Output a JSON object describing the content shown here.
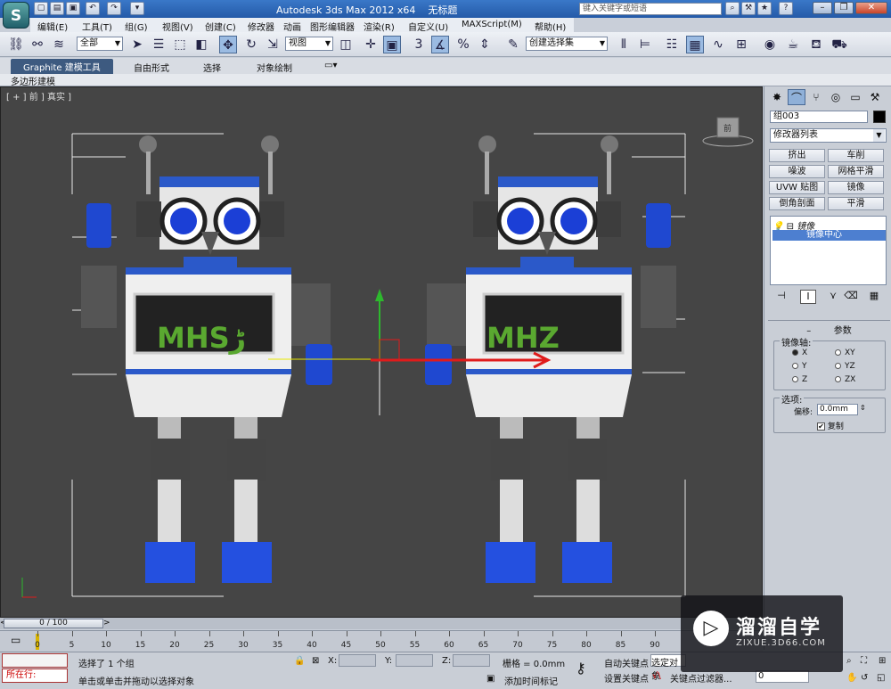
{
  "titlebar": {
    "app": "Autodesk 3ds Max  2012 x64",
    "doc": "无标题",
    "search_placeholder": "键入关键字或短语"
  },
  "menu": [
    "编辑(E)",
    "工具(T)",
    "组(G)",
    "视图(V)",
    "创建(C)",
    "修改器",
    "动画",
    "图形编辑器",
    "渲染(R)",
    "自定义(U)",
    "MAXScript(M)",
    "帮助(H)"
  ],
  "toolbar": {
    "selection_filter": "全部",
    "ref_coord": "视图",
    "named_selection": "创建选择集",
    "angle_snap": "3"
  },
  "ribbon": {
    "tabs": [
      "Graphite 建模工具",
      "自由形式",
      "选择",
      "对象绘制"
    ],
    "sub": "多边形建模"
  },
  "viewport": {
    "label": "[ + ] 前 ] 真实 ]",
    "view_cube_label": "前",
    "screen_text_left": "MHSڑ",
    "screen_text_right": "MHZ"
  },
  "command_panel": {
    "object_name": "组003",
    "modifier_list": "修改器列表",
    "modifier_buttons": [
      "挤出",
      "车削",
      "噪波",
      "网格平滑",
      "UVW 贴图",
      "镜像",
      "倒角剖面",
      "平滑"
    ],
    "stack_top": "镜像",
    "stack_sub": "镜像中心",
    "params_header": "参数",
    "mirror_axis_title": "镜像轴:",
    "axes": [
      "X",
      "XY",
      "Y",
      "YZ",
      "Z",
      "ZX"
    ],
    "options_title": "选项:",
    "offset_label": "偏移:",
    "offset_value": "0.0mm",
    "copy_label": "复制"
  },
  "timeline": {
    "frame": "0 / 100",
    "ticks": [
      "0",
      "5",
      "10",
      "15",
      "20",
      "25",
      "30",
      "35",
      "40",
      "45",
      "50",
      "55",
      "60",
      "65",
      "70",
      "75",
      "80",
      "85",
      "90"
    ]
  },
  "status": {
    "running": "所在行:",
    "selected": "选择了 1 个组",
    "hint": "单击或单击并拖动以选择对象",
    "x_label": "X:",
    "y_label": "Y:",
    "z_label": "Z:",
    "grid": "栅格 = 0.0mm",
    "add_time_tag": "添加时间标记",
    "auto_key": "自动关键点",
    "selected_obj": "选定对象",
    "set_key": "设置关键点",
    "key_filters": "关键点过滤器...",
    "frame_value": "0"
  },
  "watermark": {
    "title": "溜溜自学",
    "subtitle": "ZIXUE.3D66.COM"
  }
}
